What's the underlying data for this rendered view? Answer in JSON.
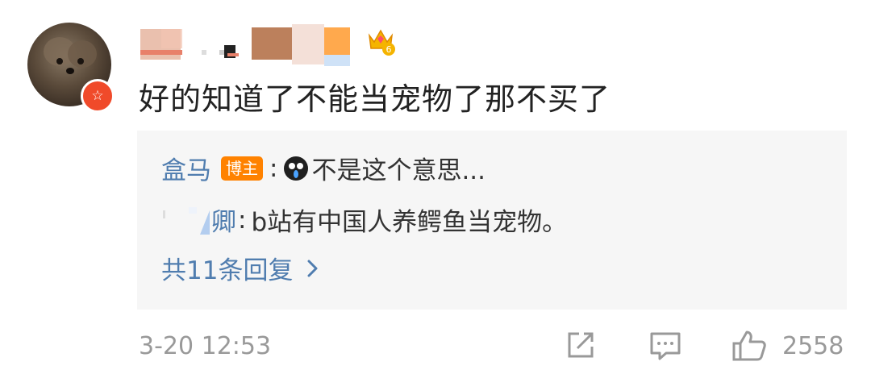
{
  "comment": {
    "text": "好的知道了不能当宠物了那不买了",
    "level_badge": "6",
    "time": "3-20 12:53",
    "like_count": "2558"
  },
  "replies": [
    {
      "author": "盒马",
      "tag": "博主",
      "separator": ":",
      "text": "不是这个意思..."
    },
    {
      "author": "卿",
      "separator": ":",
      "text": "b站有中国人养鳄鱼当宠物。"
    }
  ],
  "more_replies": "共11条回复",
  "colors": {
    "link": "#507daf",
    "badge_orange": "#ff8200",
    "vip_red": "#f04a2a",
    "meta_gray": "#999999"
  },
  "icons": [
    "vip-badge-icon",
    "crown-level-icon",
    "crying-emoji-icon",
    "chevron-right-icon",
    "share-icon",
    "comment-icon",
    "like-icon"
  ]
}
